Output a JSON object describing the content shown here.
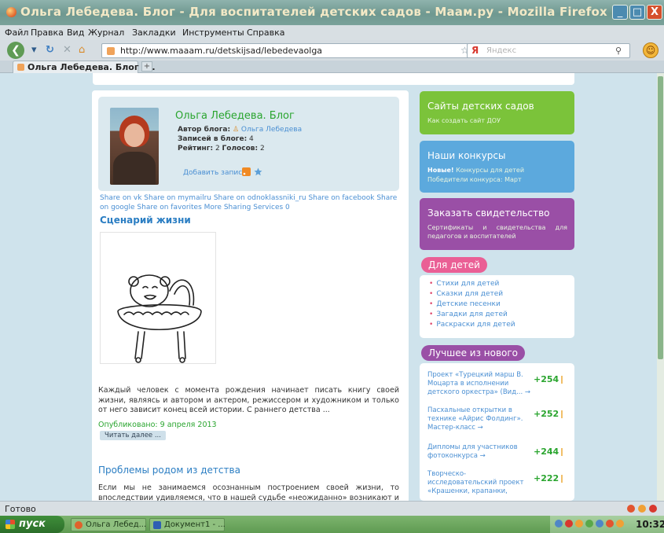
{
  "window": {
    "title": "Ольга Лебедева. Блог - Для воспитателей детских садов - Маам.ру - Mozilla Firefox",
    "minimize": "_",
    "maximize": "□",
    "close": "X"
  },
  "menu": [
    "Файл",
    "Правка",
    "Вид",
    "Журнал",
    "Закладки",
    "Инструменты",
    "Справка"
  ],
  "nav": {
    "url": "http://www.maaam.ru/detskijsad/lebedevaolga",
    "search_placeholder": "Яндекс",
    "search_engine": "Я"
  },
  "tabs": [
    {
      "label": "Ольга Лебедева. Блог -..."
    }
  ],
  "blog": {
    "title": "Ольга Лебедева. Блог",
    "author_label": "Автор блога:",
    "author_name": "Ольга Лебедева",
    "posts_label": "Записей в блоге:",
    "posts_count": "4",
    "rating_label": "Рейтинг:",
    "rating_value": "2",
    "votes_label": "Голосов:",
    "votes_value": "2",
    "add_post": "Добавить запись"
  },
  "share_text": "Share on vk Share on mymailru Share on odnoklassniki_ru Share on facebook Share on google Share on favorites More Sharing Services 0",
  "posts": [
    {
      "title": "Сценарий жизни",
      "excerpt": "Каждый человек с момента рождения начинает писать книгу своей жизни, являясь и автором и актером, режиссером и художником и только от него зависит конец всей истории. С раннего детства ...",
      "published": "Опубликовано: 9 апреля 2013",
      "read_more": "Читать далее ..."
    },
    {
      "title": "Проблемы родом из детства",
      "excerpt": "Если мы не занимаемся осознанным построением своей жизни, то впоследствии удивляемся, что в нашей судьбе «неожиданно» возникают и разрастаются проблемы"
    }
  ],
  "sidebar": {
    "cards": [
      {
        "title": "Сайты детских садов",
        "sub": "Как создать сайт ДОУ"
      },
      {
        "title": "Наши конкурсы",
        "sub_bold": "Новые!",
        "sub": " Конкурсы для детей",
        "sub2": "Победители конкурса: Март"
      },
      {
        "title": "Заказать свидетельство",
        "sub": "Сертификаты и свидетельства для педагогов и воспитателей"
      }
    ],
    "kids_title": "Для детей",
    "kids_links": [
      "Стихи для детей",
      "Сказки для детей",
      "Детские песенки",
      "Загадки для детей",
      "Раскраски для детей"
    ],
    "best_title": "Лучшее из нового",
    "best": [
      {
        "text": "Проект «Турецкий марш В. Моцарта в исполнении детского оркестра» (Вид... →",
        "score": "+254"
      },
      {
        "text": "Пасхальные открытки в технике «Айрис Фолдинг». Мастер-класс →",
        "score": "+252"
      },
      {
        "text": "Дипломы для участников фотоконкурса →",
        "score": "+244"
      },
      {
        "text": "Творческо-исследовательский проект «Крашенки, крапанки,",
        "score": "+222"
      }
    ]
  },
  "status": {
    "text": "Готово"
  },
  "taskbar": {
    "start": "пуск",
    "tasks": [
      "Ольга Лебед...",
      "Документ1 - ..."
    ],
    "clock": "10:32"
  },
  "colors": {
    "green_card": "#7bc33a",
    "blue_card": "#5ca9dd",
    "purple_card": "#9a4fa6",
    "pink_pill": "#ea5f95",
    "link": "#4a8fd3",
    "score": "#2aa52f"
  }
}
